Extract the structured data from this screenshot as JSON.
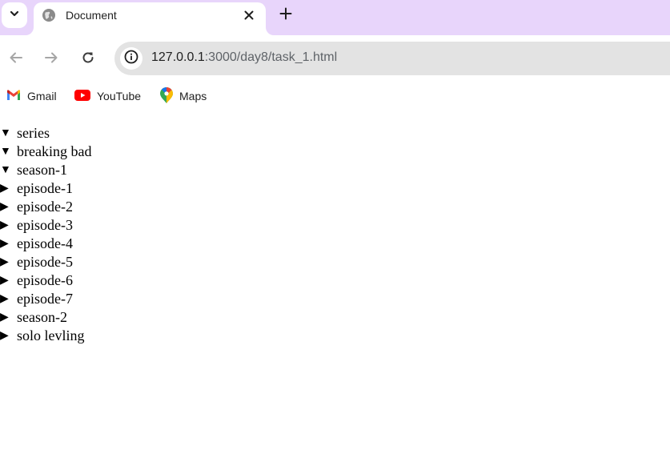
{
  "browser": {
    "tab": {
      "title": "Document"
    },
    "address": {
      "host": "127.0.0.1",
      "rest": ":3000/day8/task_1.html"
    },
    "bookmarks": [
      {
        "label": "Gmail",
        "icon": "gmail-icon"
      },
      {
        "label": "YouTube",
        "icon": "youtube-icon"
      },
      {
        "label": "Maps",
        "icon": "maps-icon"
      }
    ],
    "colors": {
      "tabstrip": "#e8d5fb",
      "omnibox": "#e3e3e3"
    }
  },
  "tree": [
    {
      "label": "series",
      "expanded": true,
      "marker": "▼"
    },
    {
      "label": "breaking bad",
      "expanded": true,
      "marker": "▼"
    },
    {
      "label": "season-1",
      "expanded": true,
      "marker": "▼"
    },
    {
      "label": "episode-1",
      "expanded": false,
      "marker": "▶"
    },
    {
      "label": "episode-2",
      "expanded": false,
      "marker": "▶"
    },
    {
      "label": "episode-3",
      "expanded": false,
      "marker": "▶"
    },
    {
      "label": "episode-4",
      "expanded": false,
      "marker": "▶"
    },
    {
      "label": "episode-5",
      "expanded": false,
      "marker": "▶"
    },
    {
      "label": "episode-6",
      "expanded": false,
      "marker": "▶"
    },
    {
      "label": "episode-7",
      "expanded": false,
      "marker": "▶"
    },
    {
      "label": "season-2",
      "expanded": false,
      "marker": "▶"
    },
    {
      "label": "solo levling",
      "expanded": false,
      "marker": "▶"
    }
  ]
}
